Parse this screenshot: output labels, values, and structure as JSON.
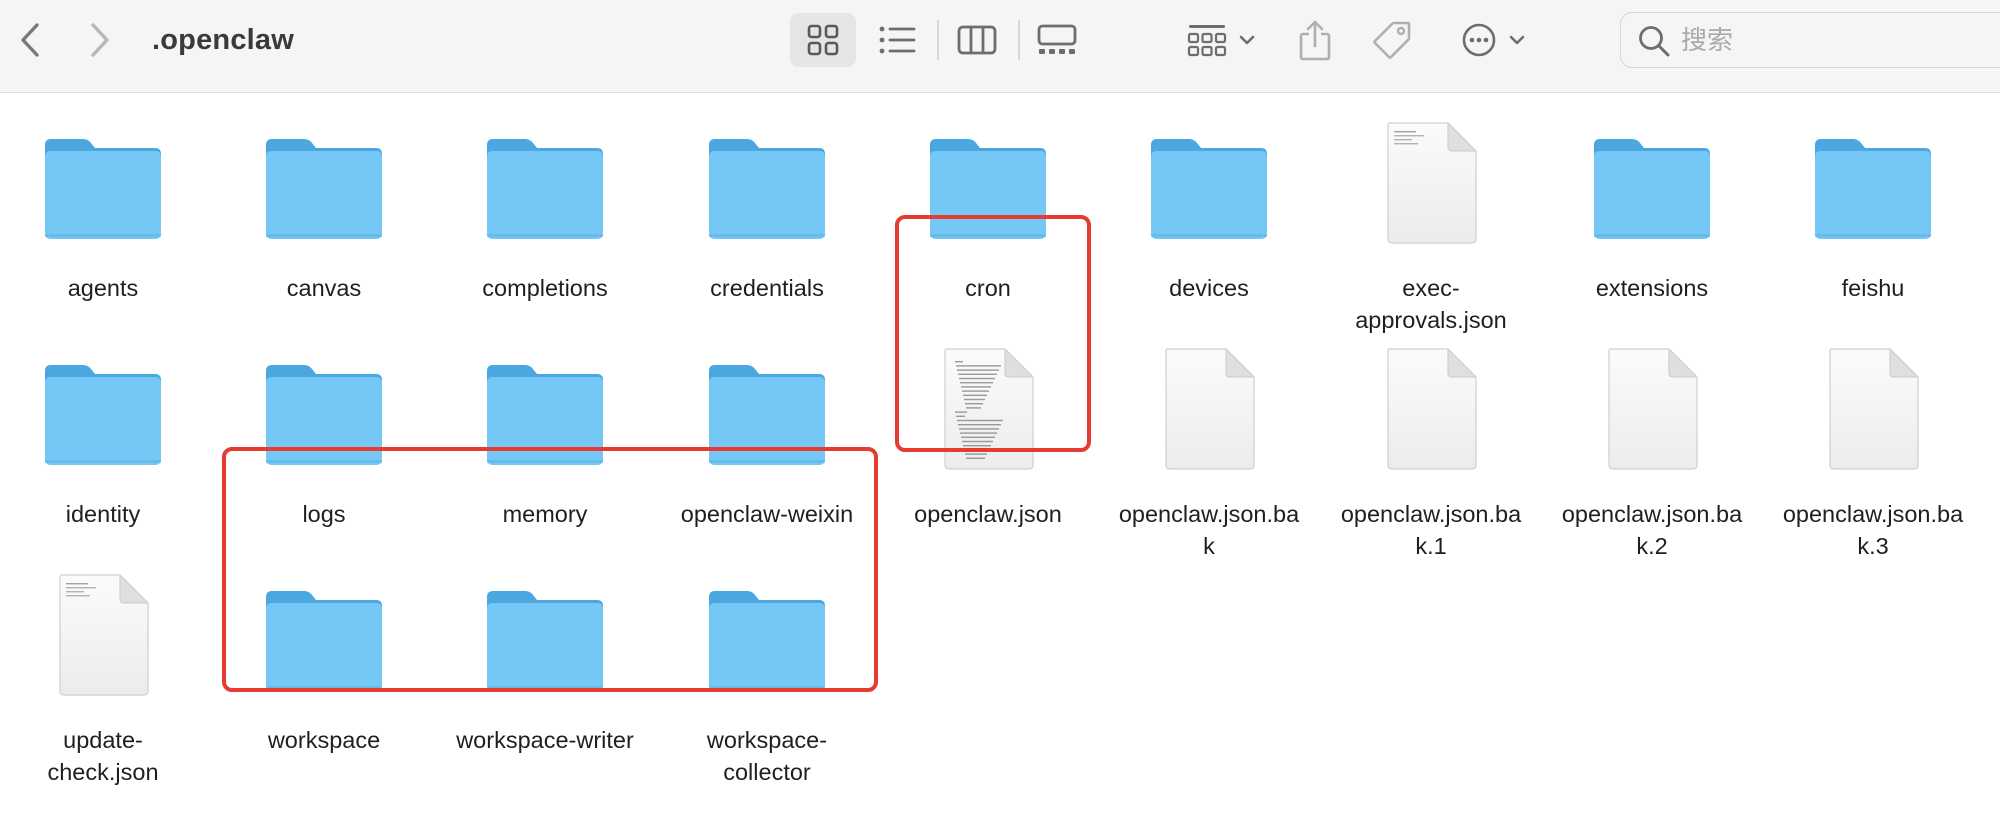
{
  "window": {
    "title": ".openclaw"
  },
  "toolbar": {
    "back_icon": "chevron-left-icon",
    "forward_icon": "chevron-right-icon",
    "view_icon": "icon-view-icon",
    "view_list": "list-view-icon",
    "view_columns": "column-view-icon",
    "view_gallery": "gallery-view-icon",
    "group_icon": "group-icon",
    "share_icon": "share-icon",
    "tag_icon": "tag-icon",
    "more_icon": "more-icon",
    "search_placeholder": "搜索"
  },
  "colors": {
    "folder_body": "#75c8f5",
    "folder_tab": "#4aa7e0",
    "highlight": "#e63b30",
    "toolbar_bg": "#f6f4f4"
  },
  "items": [
    {
      "name": "agents",
      "label_lines": [
        "agents"
      ],
      "kind": "folder"
    },
    {
      "name": "canvas",
      "label_lines": [
        "canvas"
      ],
      "kind": "folder"
    },
    {
      "name": "completions",
      "label_lines": [
        "completions"
      ],
      "kind": "folder"
    },
    {
      "name": "credentials",
      "label_lines": [
        "credentials"
      ],
      "kind": "folder"
    },
    {
      "name": "cron",
      "label_lines": [
        "cron"
      ],
      "kind": "folder"
    },
    {
      "name": "devices",
      "label_lines": [
        "devices"
      ],
      "kind": "folder"
    },
    {
      "name": "exec-approvals.json",
      "label_lines": [
        "exec-",
        "approvals.json"
      ],
      "kind": "json-doc"
    },
    {
      "name": "extensions",
      "label_lines": [
        "extensions"
      ],
      "kind": "folder"
    },
    {
      "name": "feishu",
      "label_lines": [
        "feishu"
      ],
      "kind": "folder"
    },
    {
      "name": "identity",
      "label_lines": [
        "identity"
      ],
      "kind": "folder"
    },
    {
      "name": "logs",
      "label_lines": [
        "logs"
      ],
      "kind": "folder"
    },
    {
      "name": "memory",
      "label_lines": [
        "memory"
      ],
      "kind": "folder"
    },
    {
      "name": "openclaw-weixin",
      "label_lines": [
        "openclaw-weixin"
      ],
      "kind": "folder"
    },
    {
      "name": "openclaw.json",
      "label_lines": [
        "openclaw.json"
      ],
      "kind": "json-doc-rich"
    },
    {
      "name": "openclaw.json.bak",
      "label_lines": [
        "openclaw.json.ba",
        "k"
      ],
      "kind": "blank-doc"
    },
    {
      "name": "openclaw.json.bak.1",
      "label_lines": [
        "openclaw.json.ba",
        "k.1"
      ],
      "kind": "blank-doc"
    },
    {
      "name": "openclaw.json.bak.2",
      "label_lines": [
        "openclaw.json.ba",
        "k.2"
      ],
      "kind": "blank-doc"
    },
    {
      "name": "openclaw.json.bak.3",
      "label_lines": [
        "openclaw.json.ba",
        "k.3"
      ],
      "kind": "blank-doc"
    },
    {
      "name": "update-check.json",
      "label_lines": [
        "update-",
        "check.json"
      ],
      "kind": "json-doc"
    },
    {
      "name": "workspace",
      "label_lines": [
        "workspace"
      ],
      "kind": "folder"
    },
    {
      "name": "workspace-writer",
      "label_lines": [
        "workspace-writer"
      ],
      "kind": "folder"
    },
    {
      "name": "workspace-collector",
      "label_lines": [
        "workspace-",
        "collector"
      ],
      "kind": "folder"
    }
  ],
  "highlights": [
    {
      "name": "openclaw-json-highlight",
      "covers": [
        "openclaw.json"
      ]
    },
    {
      "name": "workspace-folders-highlight",
      "covers": [
        "workspace",
        "workspace-writer",
        "workspace-collector"
      ]
    }
  ]
}
